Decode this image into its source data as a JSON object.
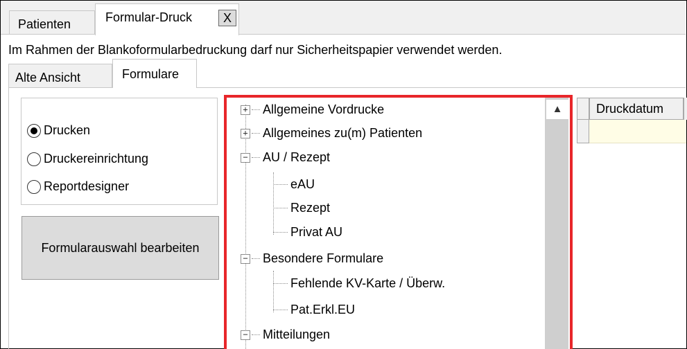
{
  "tabs": [
    {
      "label": "Patienten"
    },
    {
      "label": "Formular-Druck"
    }
  ],
  "tab_close": "X",
  "notice": "Im Rahmen der Blankoformularbedruckung darf nur Sicherheitspapier verwendet werden.",
  "subtabs": [
    {
      "label": "Alte Ansicht"
    },
    {
      "label": "Formulare"
    }
  ],
  "radio_options": [
    {
      "label": "Drucken",
      "selected": true
    },
    {
      "label": "Druckereinrichtung",
      "selected": false
    },
    {
      "label": "Reportdesigner",
      "selected": false
    }
  ],
  "edit_button": "Formularauswahl bearbeiten",
  "tree": {
    "items": [
      {
        "label": "Allgemeine Vordrucke",
        "expander": "+"
      },
      {
        "label": "Allgemeines zu(m) Patienten",
        "expander": "+"
      },
      {
        "label": "AU / Rezept",
        "expander": "−"
      },
      {
        "label": "eAU"
      },
      {
        "label": "Rezept"
      },
      {
        "label": "Privat AU"
      },
      {
        "label": "Besondere Formulare",
        "expander": "−"
      },
      {
        "label": "Fehlende KV-Karte / Überw."
      },
      {
        "label": "Pat.Erkl.EU"
      },
      {
        "label": "Mitteilungen",
        "expander": "−"
      }
    ],
    "scroll_up": "▲"
  },
  "grid": {
    "column": "Druckdatum"
  },
  "colors": {
    "highlight": "#e8262a",
    "grid_row": "#fffde6",
    "scrollbar": "#cfcfcf"
  }
}
